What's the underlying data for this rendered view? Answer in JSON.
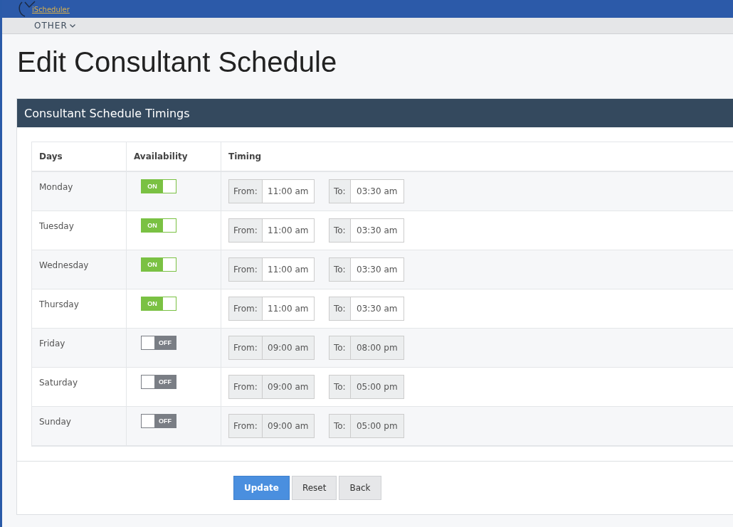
{
  "brand": {
    "name": "iScheduler"
  },
  "nav": {
    "label": "OTHER"
  },
  "page": {
    "title": "Edit Consultant Schedule"
  },
  "panel": {
    "title": "Consultant Schedule Timings"
  },
  "table": {
    "columns": [
      "Days",
      "Availability",
      "Timing"
    ],
    "rows": [
      {
        "day": "Monday",
        "on": true,
        "toggle_label": "ON",
        "from_label": "From:",
        "from": "11:00 am",
        "to_label": "To:",
        "to": "03:30 am"
      },
      {
        "day": "Tuesday",
        "on": true,
        "toggle_label": "ON",
        "from_label": "From:",
        "from": "11:00 am",
        "to_label": "To:",
        "to": "03:30 am"
      },
      {
        "day": "Wednesday",
        "on": true,
        "toggle_label": "ON",
        "from_label": "From:",
        "from": "11:00 am",
        "to_label": "To:",
        "to": "03:30 am"
      },
      {
        "day": "Thursday",
        "on": true,
        "toggle_label": "ON",
        "from_label": "From:",
        "from": "11:00 am",
        "to_label": "To:",
        "to": "03:30 am"
      },
      {
        "day": "Friday",
        "on": false,
        "toggle_label": "OFF",
        "from_label": "From:",
        "from": "09:00 am",
        "to_label": "To:",
        "to": "08:00 pm"
      },
      {
        "day": "Saturday",
        "on": false,
        "toggle_label": "OFF",
        "from_label": "From:",
        "from": "09:00 am",
        "to_label": "To:",
        "to": "05:00 pm"
      },
      {
        "day": "Sunday",
        "on": false,
        "toggle_label": "OFF",
        "from_label": "From:",
        "from": "09:00 am",
        "to_label": "To:",
        "to": "05:00 pm"
      }
    ]
  },
  "buttons": [
    {
      "label": "Update",
      "kind": "primary"
    },
    {
      "label": "Reset",
      "kind": "default"
    },
    {
      "label": "Back",
      "kind": "default"
    }
  ]
}
